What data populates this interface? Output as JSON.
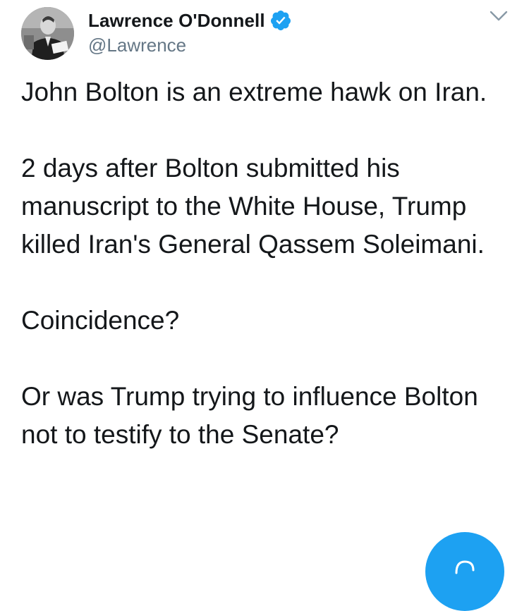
{
  "author": {
    "name": "Lawrence O'Donnell",
    "handle": "@Lawrence",
    "verified": true
  },
  "tweet": {
    "paragraphs": [
      "John Bolton is an extreme hawk on Iran.",
      "2 days after Bolton submitted his manuscript to the White House, Trump killed Iran's General Qassem Soleimani.",
      "Coincidence?",
      "Or was Trump trying to influence Bolton not to testify to the Senate?"
    ]
  },
  "colors": {
    "accent": "#1da1f2",
    "text_primary": "#14171a",
    "text_secondary": "#657786"
  },
  "icons": {
    "badge": "verified-badge-icon",
    "menu": "chevron-down-icon",
    "compose": "compose-icon"
  }
}
